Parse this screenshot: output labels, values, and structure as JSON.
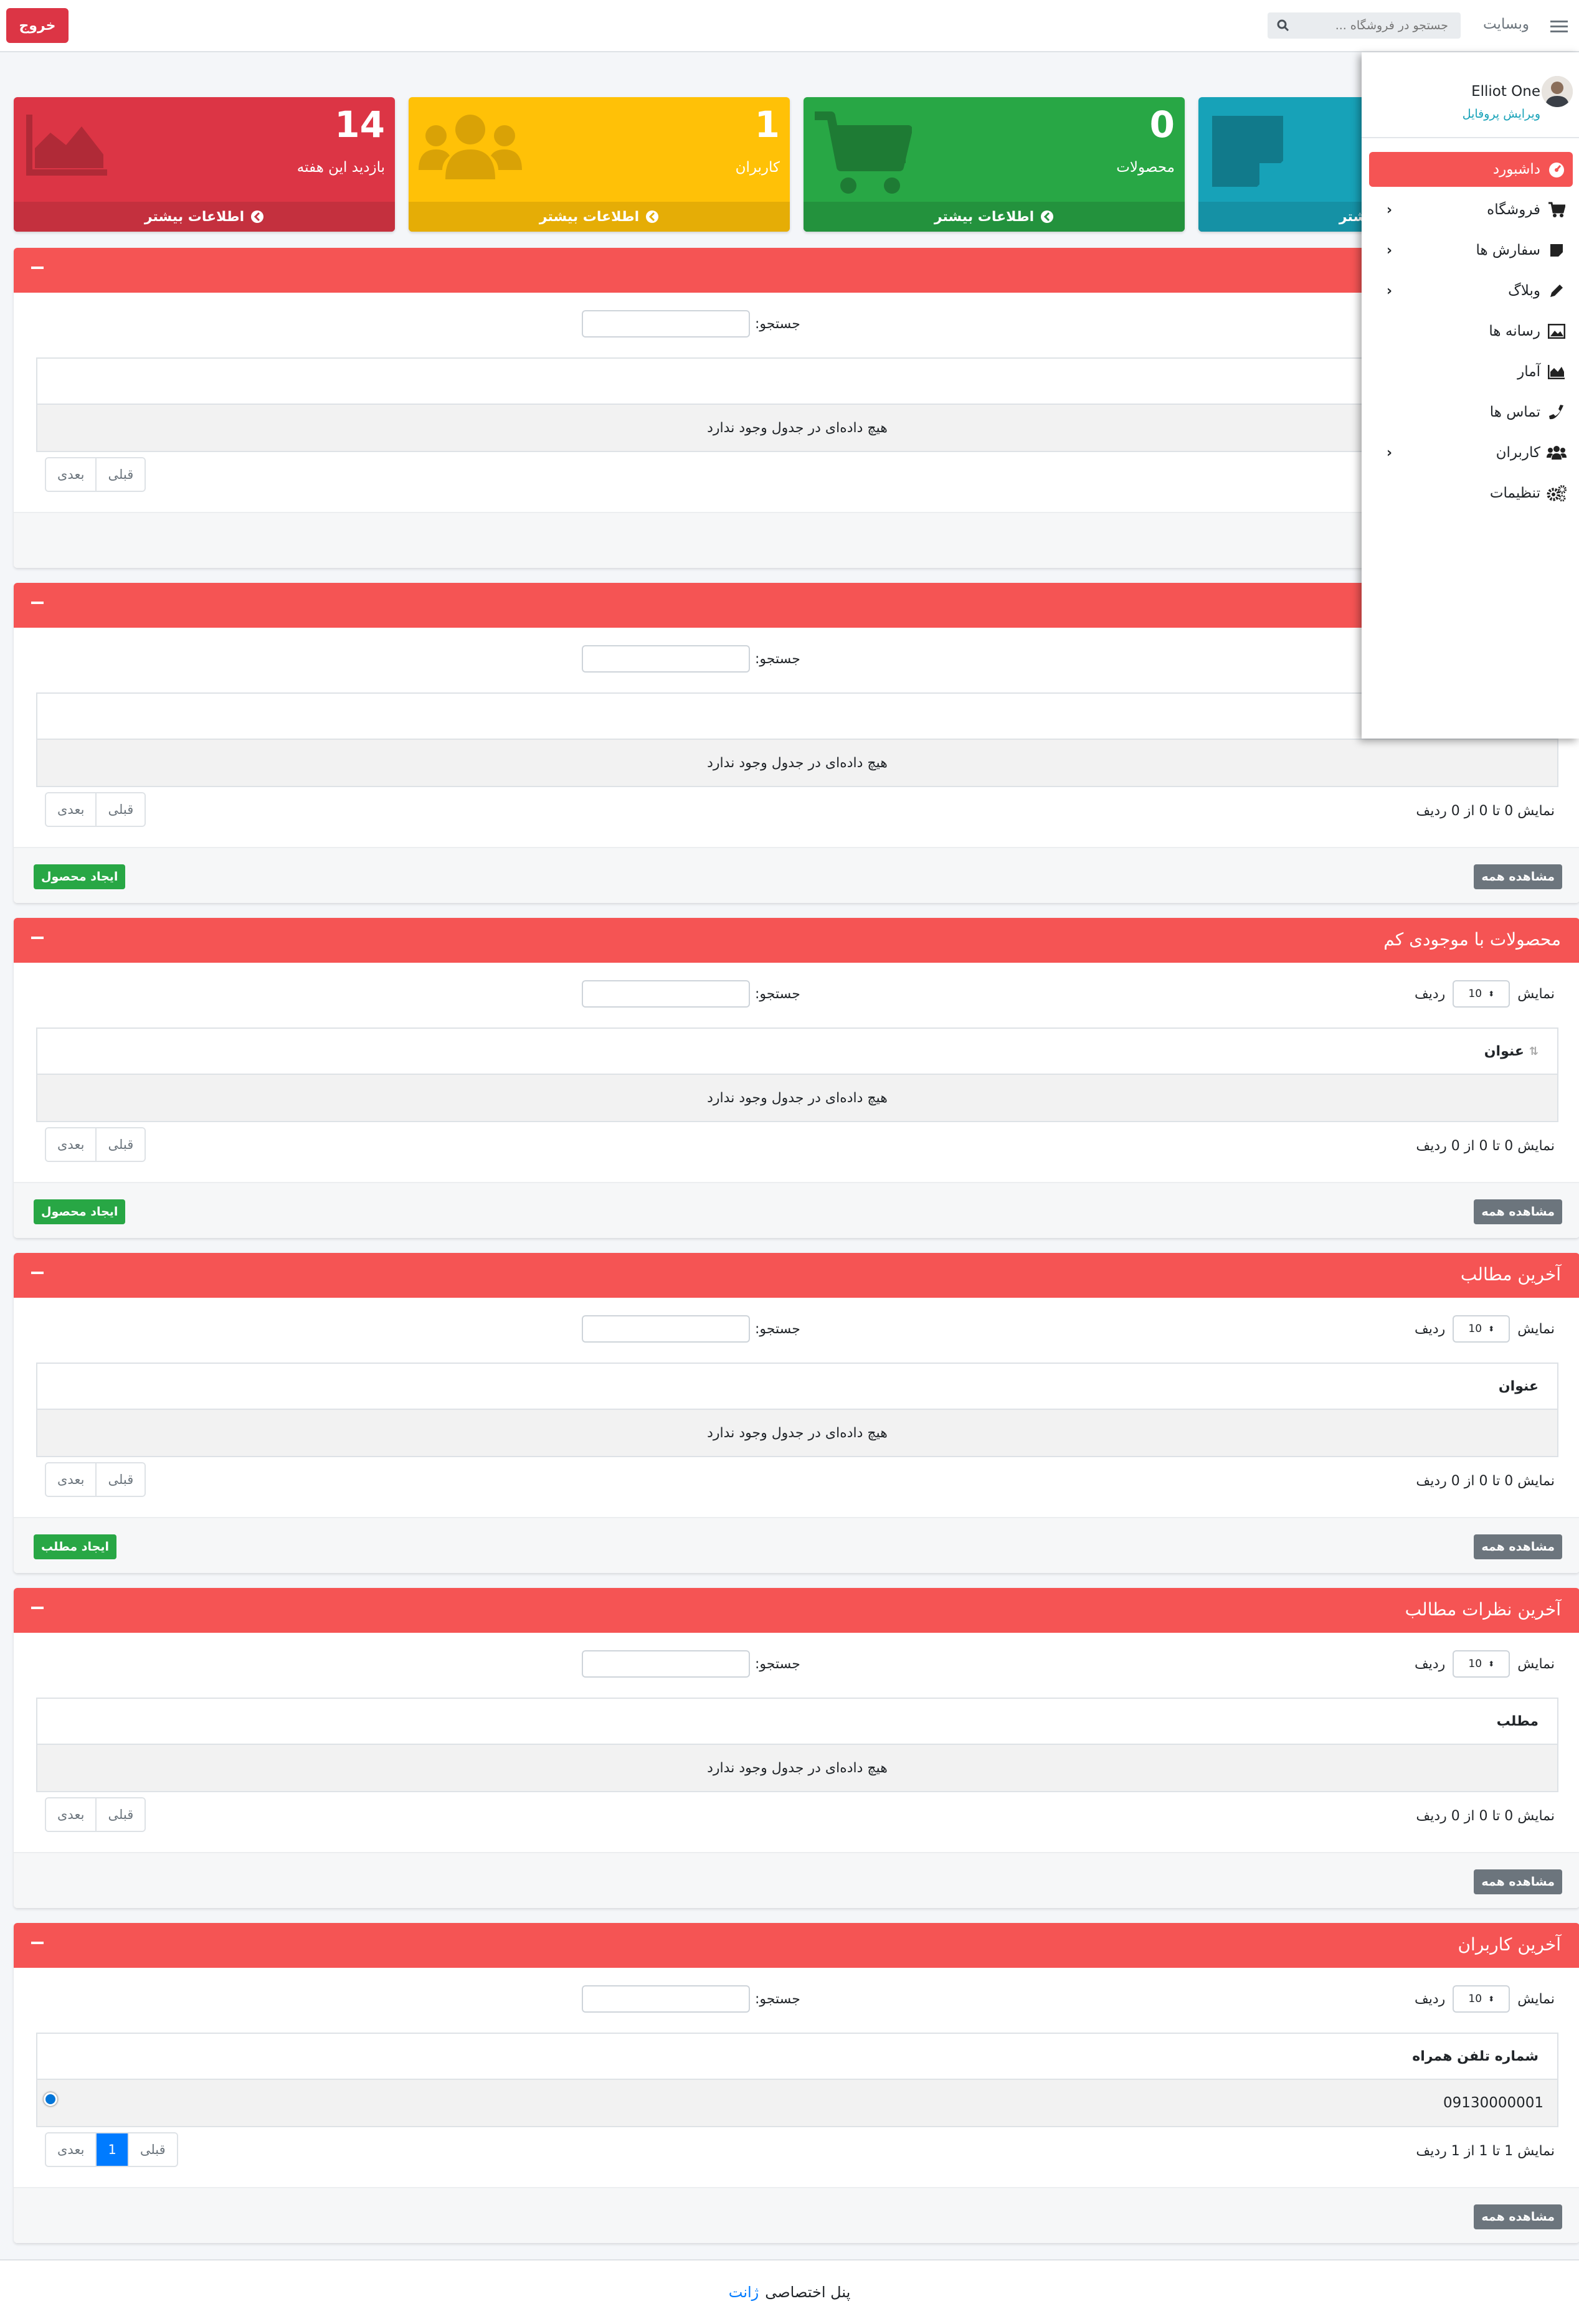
{
  "navbar": {
    "logout_label": "خروج",
    "site_link": "وبسایت",
    "search_placeholder": "جستجو در فروشگاه ..."
  },
  "stat_boxes": [
    {
      "number": "14",
      "label": "بازدید این هفته",
      "more": "اطلاعات بیشتر",
      "color": "#dc3545"
    },
    {
      "number": "1",
      "label": "کاربران",
      "more": "اطلاعات بیشتر",
      "color": "#ffc107"
    },
    {
      "number": "0",
      "label": "محصولات",
      "more": "اطلاعات بیشتر",
      "color": "#28a745"
    },
    {
      "number": "",
      "label": "",
      "more": "اطلاعات بیشتر",
      "color": "#17a2b8"
    }
  ],
  "tables": {
    "search_label": "جستجو:",
    "show_label": "نمایش",
    "rows_label": "ردیف",
    "page_length": "10",
    "empty_text": "هیچ داده‌ای در جدول وجود ندارد",
    "prev_label": "قبلی",
    "next_label": "بعدی",
    "view_all_label": "مشاهده همه",
    "info_empty": "نمایش 0 تا 0 از 0 ردیف",
    "info_users": "نمایش 1 تا 1 از 1 ردیف"
  },
  "cards": [
    {
      "title": ""
    },
    {
      "title": "",
      "create_label": "ایجاد محصول"
    },
    {
      "title": "محصولات با موجودی کم",
      "column": "عنوان",
      "create_label": "ایجاد محصول"
    },
    {
      "title": "آخرین مطالب",
      "column": "عنوان",
      "create_label": "ایجاد مطلب"
    },
    {
      "title": "آخرین نظرات مطالب",
      "column": "مطلب"
    },
    {
      "title": "آخرین کاربران",
      "column": "شماره تلفن همراه",
      "row_value": "09130000001",
      "page": "1"
    }
  ],
  "sidebar": {
    "user_name": "Elliot One",
    "edit_profile": "ویرایش پروفایل",
    "items": [
      {
        "label": "داشبورد",
        "icon": "dashboard-icon",
        "active": true
      },
      {
        "label": "فروشگاه",
        "icon": "cart-icon",
        "has_children": true
      },
      {
        "label": "سفارش ها",
        "icon": "note-icon",
        "has_children": true
      },
      {
        "label": "وبلاگ",
        "icon": "pencil-icon",
        "has_children": true
      },
      {
        "label": "رسانه ها",
        "icon": "image-icon"
      },
      {
        "label": "آمار",
        "icon": "chart-area-icon"
      },
      {
        "label": "تماس ها",
        "icon": "phone-icon"
      },
      {
        "label": "کاربران",
        "icon": "users-icon",
        "has_children": true
      },
      {
        "label": "تنظیمات",
        "icon": "cogs-icon"
      }
    ]
  },
  "footer": {
    "text": "پنل اختصاصی",
    "brand": "ژانت"
  }
}
